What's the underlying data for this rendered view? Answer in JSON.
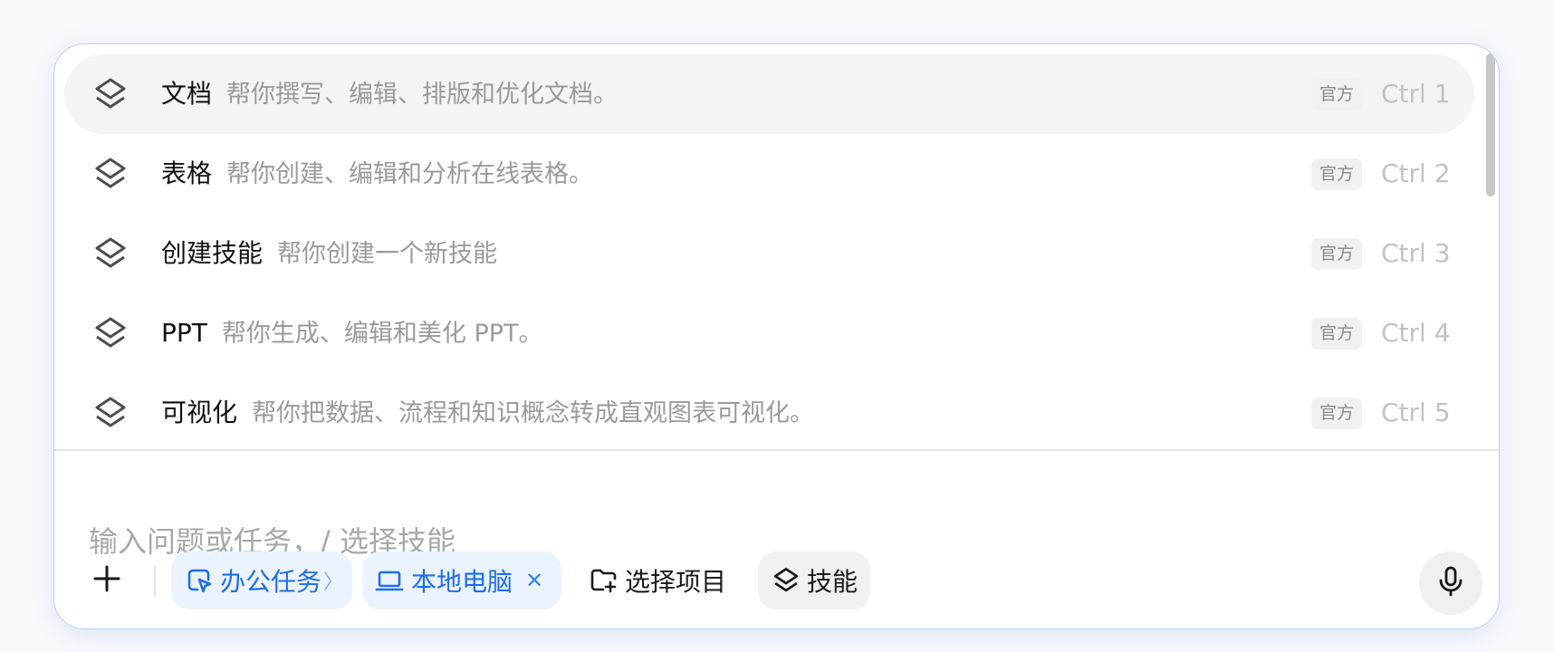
{
  "skills": [
    {
      "name": "文档",
      "description": "帮你撰写、编辑、排版和优化文档。",
      "badge": "官方",
      "shortcut": "Ctrl 1",
      "selected": true
    },
    {
      "name": "表格",
      "description": "帮你创建、编辑和分析在线表格。",
      "badge": "官方",
      "shortcut": "Ctrl 2",
      "selected": false
    },
    {
      "name": "创建技能",
      "description": "帮你创建一个新技能",
      "badge": "官方",
      "shortcut": "Ctrl 3",
      "selected": false
    },
    {
      "name": "PPT",
      "description": "帮你生成、编辑和美化 PPT。",
      "badge": "官方",
      "shortcut": "Ctrl 4",
      "selected": false
    },
    {
      "name": "可视化",
      "description": "帮你把数据、流程和知识概念转成直观图表可视化。",
      "badge": "官方",
      "shortcut": "Ctrl 5",
      "selected": false
    }
  ],
  "input": {
    "placeholder": "输入问题或任务，/ 选择技能"
  },
  "toolbar": {
    "add_icon": "plus-icon",
    "task_chip": {
      "label": "办公任务",
      "icon": "pointer-icon",
      "suffix": "〉"
    },
    "computer_chip": {
      "label": "本地电脑",
      "icon": "laptop-icon",
      "close": "✕"
    },
    "project_chip": {
      "label": "选择项目",
      "icon": "folder-add-icon"
    },
    "skill_chip": {
      "label": "技能",
      "icon": "layers-icon"
    },
    "mic_icon": "microphone-icon"
  },
  "colors": {
    "accent": "#1f6fe5",
    "chip_bg": "#ebf3ff",
    "panel_border": "#b7d1f5",
    "selected_row": "#f4f4f4"
  }
}
